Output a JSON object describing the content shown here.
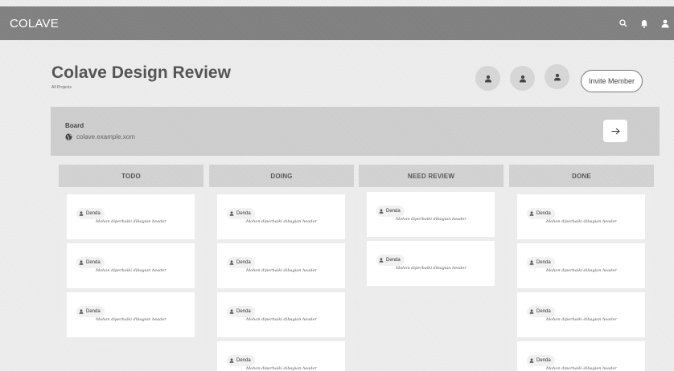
{
  "app": {
    "brand": "COLAVE"
  },
  "header": {
    "title": "Colave Design Review",
    "subtitle": "All Projects",
    "invite_label": "Invite Member"
  },
  "board": {
    "label": "Board",
    "url": "colave.example.xom"
  },
  "columns": [
    {
      "title": "TODO",
      "cards": [
        {
          "user": "Denda",
          "text": "Mohon diperbaiki dibagian header"
        },
        {
          "user": "Denda",
          "text": "Mohon diperbaiki dibagian header"
        },
        {
          "user": "Denda",
          "text": "Mohon diperbaiki dibagian header"
        }
      ]
    },
    {
      "title": "DOING",
      "cards": [
        {
          "user": "Denda",
          "text": "Mohon diperbaiki dibagian header"
        },
        {
          "user": "Denda",
          "text": "Mohon diperbaiki dibagian header"
        },
        {
          "user": "Denda",
          "text": "Mohon diperbaiki dibagian header"
        },
        {
          "user": "Denda",
          "text": "Mohon diperbaiki dibagian header"
        }
      ]
    },
    {
      "title": "NEED REVIEW",
      "cards": [
        {
          "user": "Denda",
          "text": "Mohon diperbaiki dibagian header"
        },
        {
          "user": "Denda",
          "text": "Mohon diperbaiki dibagian header"
        }
      ]
    },
    {
      "title": "DONE",
      "cards": [
        {
          "user": "Denda",
          "text": "Mohon diperbaiki dibagian header"
        },
        {
          "user": "Denda",
          "text": "Mohon diperbaiki dibagian header"
        },
        {
          "user": "Denda",
          "text": "Mohon diperbaiki dibagian header"
        },
        {
          "user": "Denda",
          "text": "Mohon diperbaiki dibagian header"
        }
      ]
    }
  ],
  "icons": {
    "search": "search-icon",
    "notifications": "bell-icon",
    "account": "user-icon",
    "board_url": "globe-icon",
    "open_board": "arrow-right-icon",
    "member": "user-icon"
  },
  "colors": {
    "navbar": "#7f7f7f",
    "board_panel": "#cfcfcf",
    "column_header": "#d4d4d4"
  }
}
